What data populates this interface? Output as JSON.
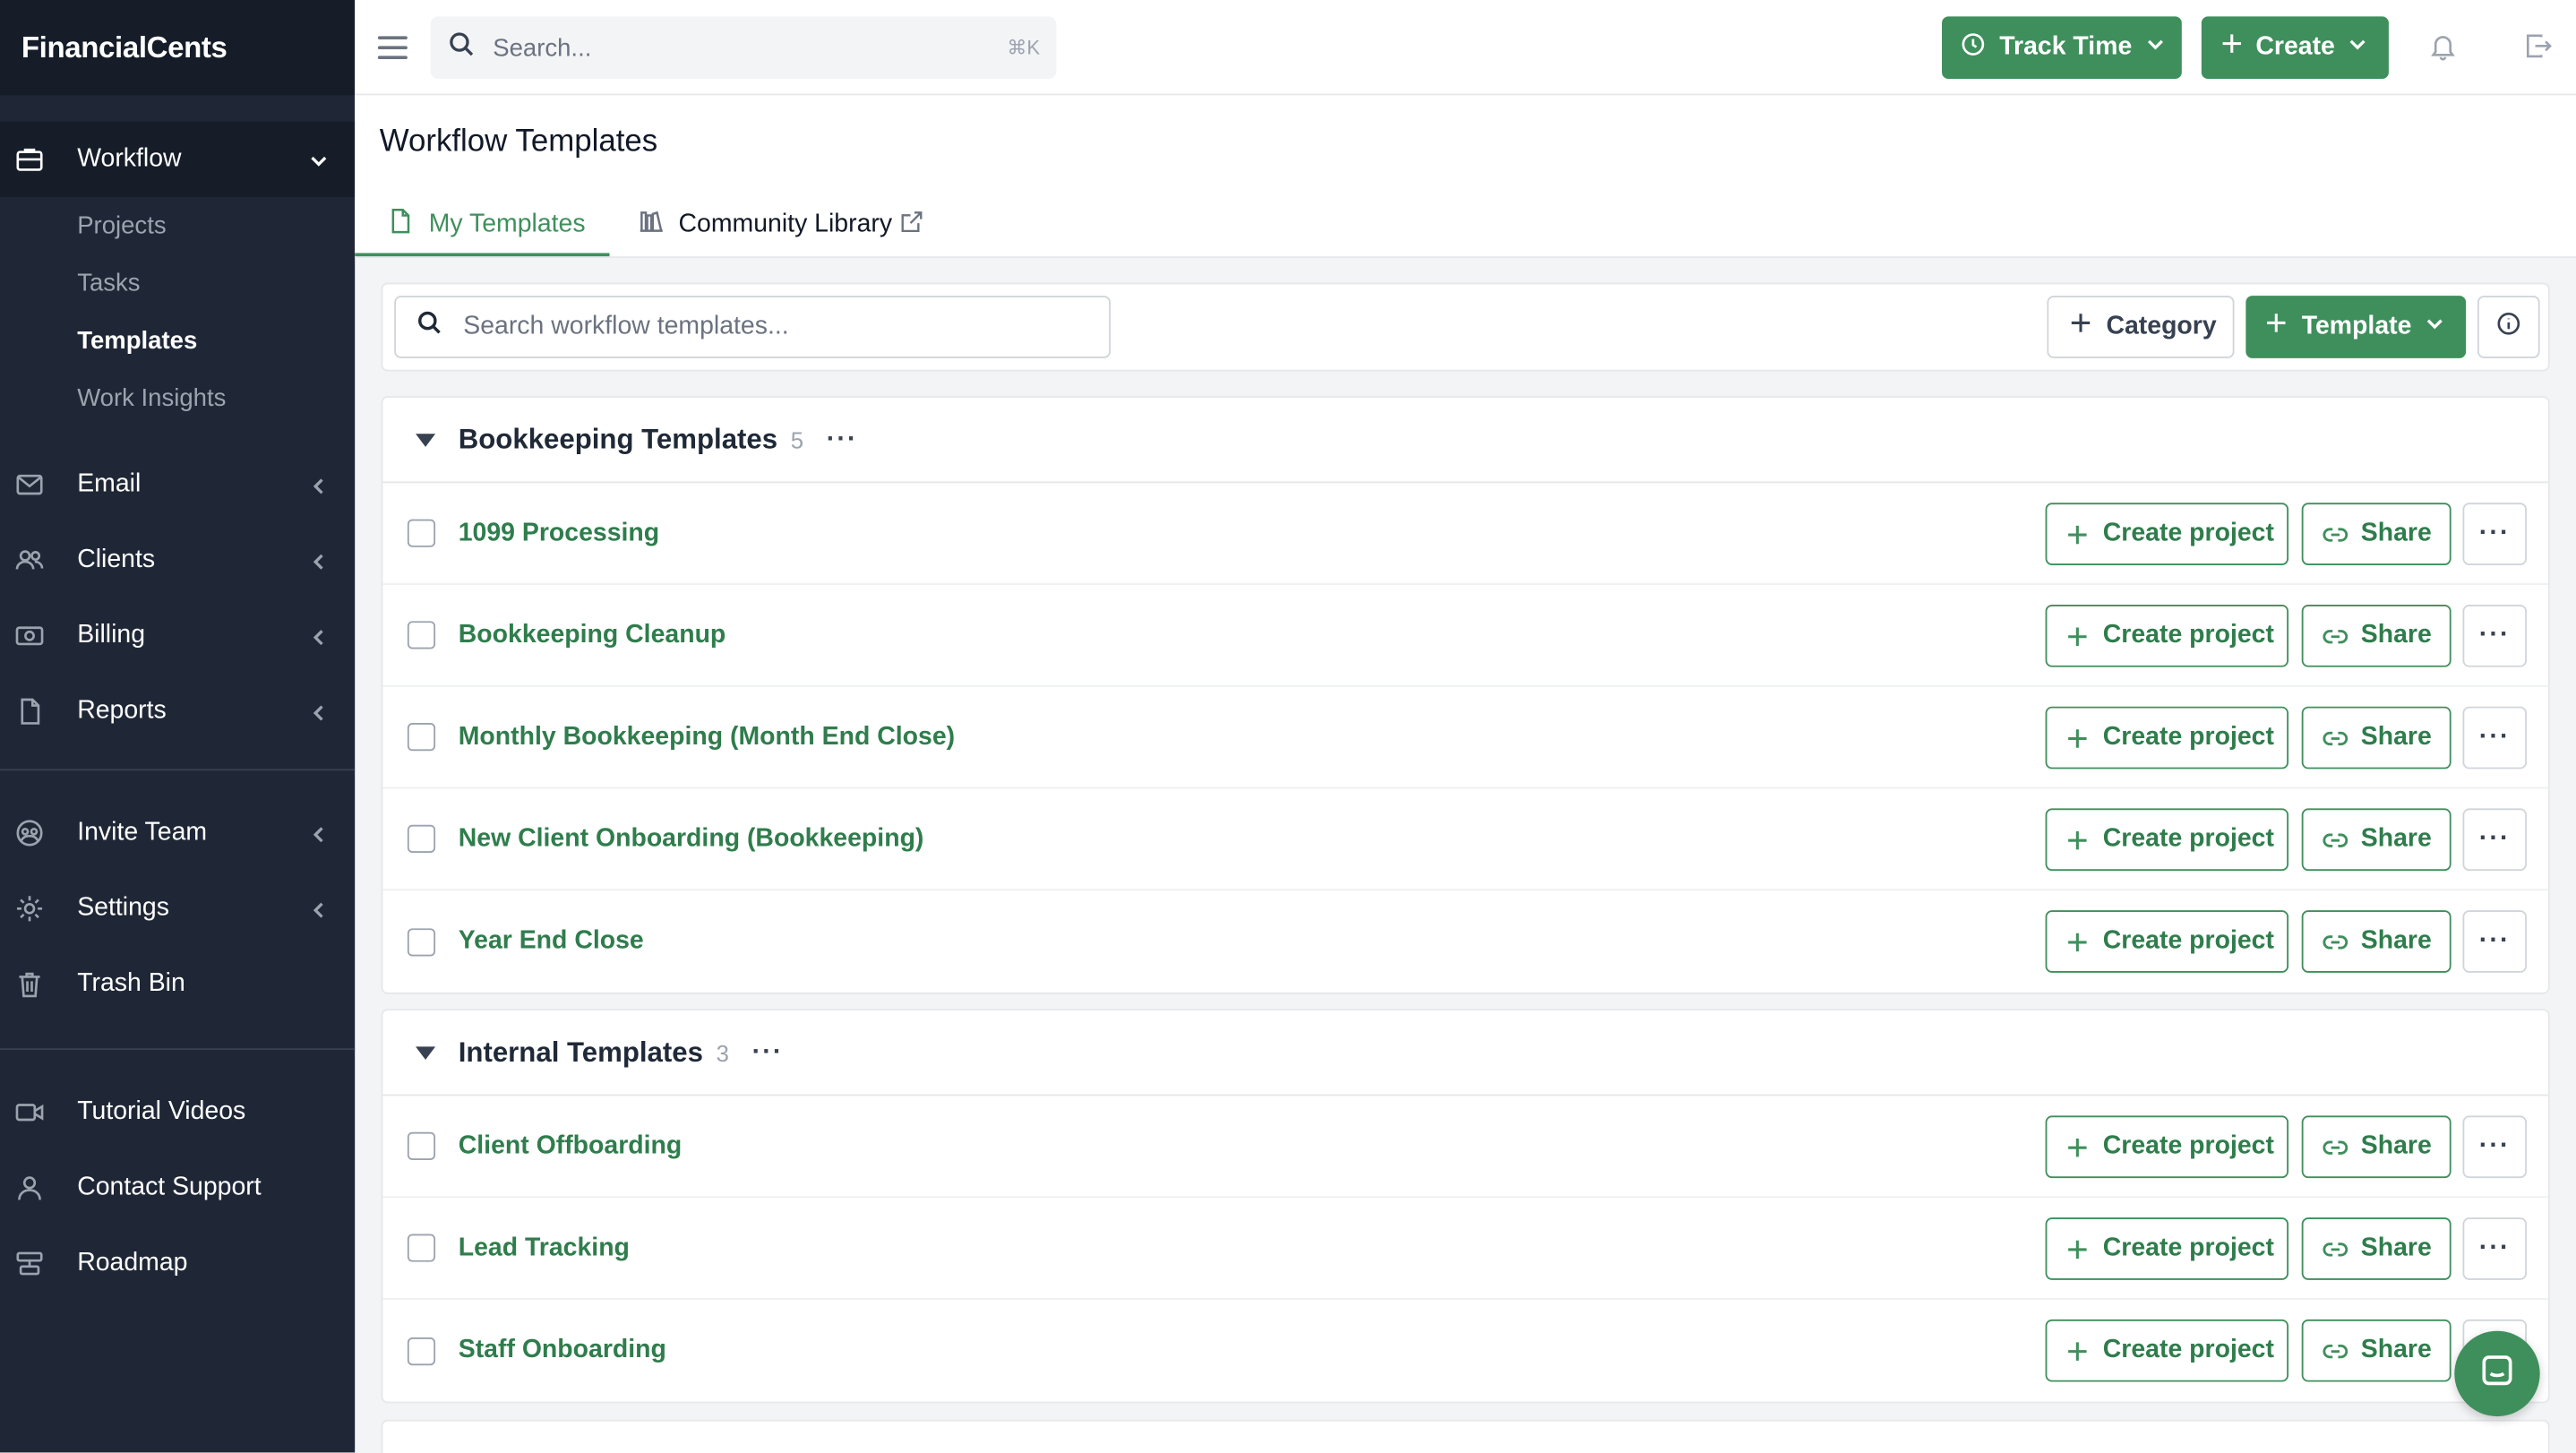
{
  "app": {
    "brand": "FinancialCents"
  },
  "colors": {
    "accent": "#3f8f5c",
    "sidebar_bg": "#1f2736"
  },
  "sidebar": {
    "workflow": {
      "label": "Workflow",
      "icon": "briefcase-icon"
    },
    "sub_items": [
      {
        "label": "Projects"
      },
      {
        "label": "Tasks"
      },
      {
        "label": "Templates"
      },
      {
        "label": "Work Insights"
      }
    ],
    "items": [
      {
        "label": "Email",
        "icon": "mail-icon"
      },
      {
        "label": "Clients",
        "icon": "users-icon"
      },
      {
        "label": "Billing",
        "icon": "money-icon"
      },
      {
        "label": "Reports",
        "icon": "file-icon"
      }
    ],
    "items2": [
      {
        "label": "Invite Team",
        "icon": "team-icon"
      },
      {
        "label": "Settings",
        "icon": "gear-icon"
      },
      {
        "label": "Trash Bin",
        "icon": "trash-icon"
      }
    ],
    "items3": [
      {
        "label": "Tutorial Videos",
        "icon": "video-icon"
      },
      {
        "label": "Contact Support",
        "icon": "person-icon"
      },
      {
        "label": "Roadmap",
        "icon": "roadmap-icon"
      }
    ]
  },
  "topbar": {
    "search_placeholder": "Search...",
    "shortcut": "⌘K",
    "track_time": "Track Time",
    "create": "Create"
  },
  "page": {
    "title": "Workflow Templates",
    "tabs": {
      "my": "My Templates",
      "community": "Community Library"
    }
  },
  "toolbar": {
    "search_placeholder": "Search workflow templates...",
    "category": "Category",
    "template": "Template"
  },
  "row_actions": {
    "create_project": "Create project",
    "share": "Share"
  },
  "groups": [
    {
      "title": "Bookkeeping Templates",
      "count": "5",
      "rows": [
        "1099 Processing",
        "Bookkeeping Cleanup",
        "Monthly Bookkeeping (Month End Close)",
        "New Client Onboarding (Bookkeeping)",
        "Year End Close"
      ]
    },
    {
      "title": "Internal Templates",
      "count": "3",
      "rows": [
        "Client Offboarding",
        "Lead Tracking",
        "Staff Onboarding"
      ]
    }
  ]
}
